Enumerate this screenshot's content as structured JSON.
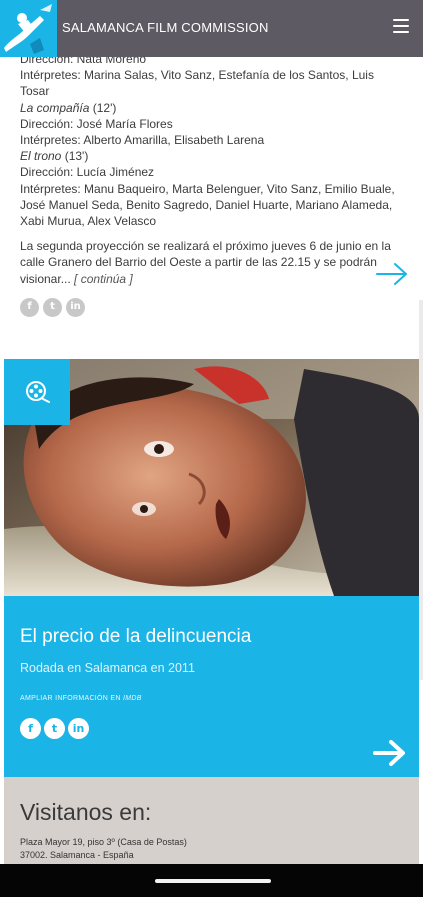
{
  "header": {
    "brand": "SALAMANCA FILM COMMISSION",
    "menu_icon": "hamburger-menu-icon"
  },
  "article": {
    "lines": [
      {
        "text": "Dirección: Nata Moreno",
        "style": "cut"
      },
      {
        "text": "Intérpretes: Marina Salas, Vito Sanz, Estefanía de los Santos, Luis Tosar",
        "style": "normal"
      },
      {
        "text": "La compañía",
        "suffix": "  (12')",
        "style": "title"
      },
      {
        "text": "Dirección: José María Flores",
        "style": "normal"
      },
      {
        "text": "Intérpretes: Alberto Amarilla, Elisabeth Larena",
        "style": "normal"
      },
      {
        "text": "El trono",
        "suffix": " (13')",
        "style": "title"
      },
      {
        "text": "Dirección: Lucía Jiménez",
        "style": "normal"
      },
      {
        "text": "Intérpretes: Manu Baqueiro, Marta Belenguer, Vito Sanz, Emilio Buale, José Manuel Seda, Benito Sagredo, Daniel Huarte, Mariano Alameda, Xabi Murua, Alex Velasco",
        "style": "normal"
      }
    ],
    "paragraph": "La segunda proyección se realizará el próximo jueves 6 de junio en la calle Granero del Barrio del Oeste a partir de las 22.15 y se podrán visionar...",
    "more_link": "[ continúa ]",
    "social": [
      "f",
      "t",
      "in"
    ]
  },
  "film": {
    "title": "El precio de la delincuencia",
    "subtitle": "Rodada en Salamanca en 2011",
    "imdb_prefix": "AMPLIAR INFORMACIÓN EN ",
    "imdb_link": "IMDB",
    "social": [
      "f",
      "t",
      "in"
    ],
    "icon": "film-reel-icon"
  },
  "footer": {
    "title": "Visitanos en:",
    "address_line1": "Plaza Mayor 19, piso 3º (Casa de Postas)",
    "address_line2": "37002. Salamanca - España"
  },
  "colors": {
    "accent": "#1ab4e6",
    "topbar": "#5e5a63",
    "footer": "#d6d0cd"
  }
}
